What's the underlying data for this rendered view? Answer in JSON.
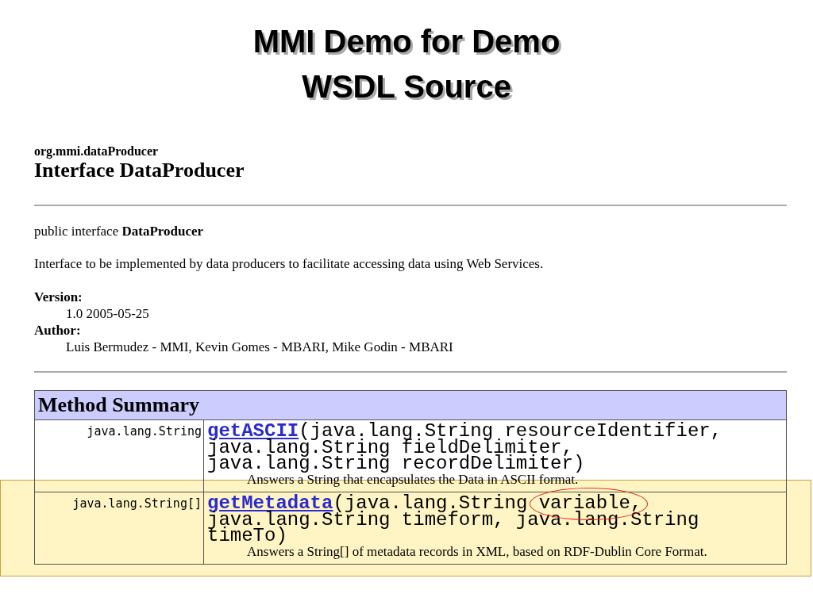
{
  "slide_title": [
    "MMI Demo for Demo",
    "WSDL Source"
  ],
  "package": "org.mmi.dataProducer",
  "heading": "Interface DataProducer",
  "declaration": "public interface **DataProducer**",
  "description": "Interface to be implemented by data producers to facilitate accessing data using Web Services.",
  "tags": [
    {
      "label": "Version:",
      "value": "1.0 2005-05-25"
    },
    {
      "label": "Author:",
      "value": "Luis Bermudez - MMI, Kevin Gomes - MBARI, Mike Godin - MBARI"
    }
  ],
  "method_summary": {
    "title": "Method Summary",
    "rows": [
      {
        "return_type": "java.lang.String",
        "method": "getASCII",
        "params": [
          {
            "text": "(java.lang.String resourceIdentifier,\njava.lang.String fieldDelimiter,\njava.lang.String recordDelimiter)",
            "circled": false
          }
        ],
        "description": "Answers a String that encapsulates the Data in ASCII format.",
        "highlighted": false
      },
      {
        "return_type": "java.lang.String[]",
        "method": "getMetadata",
        "params": [
          {
            "text": "(java.lang.String ",
            "circled": false
          },
          {
            "text": "variable,",
            "circled": true
          },
          {
            "text": "\njava.lang.String timeform, java.lang.String timeTo)",
            "circled": false
          }
        ],
        "description": "Answers a String[] of metadata records in XML, based on RDF-Dublin Core Format.",
        "highlighted": true
      }
    ]
  }
}
